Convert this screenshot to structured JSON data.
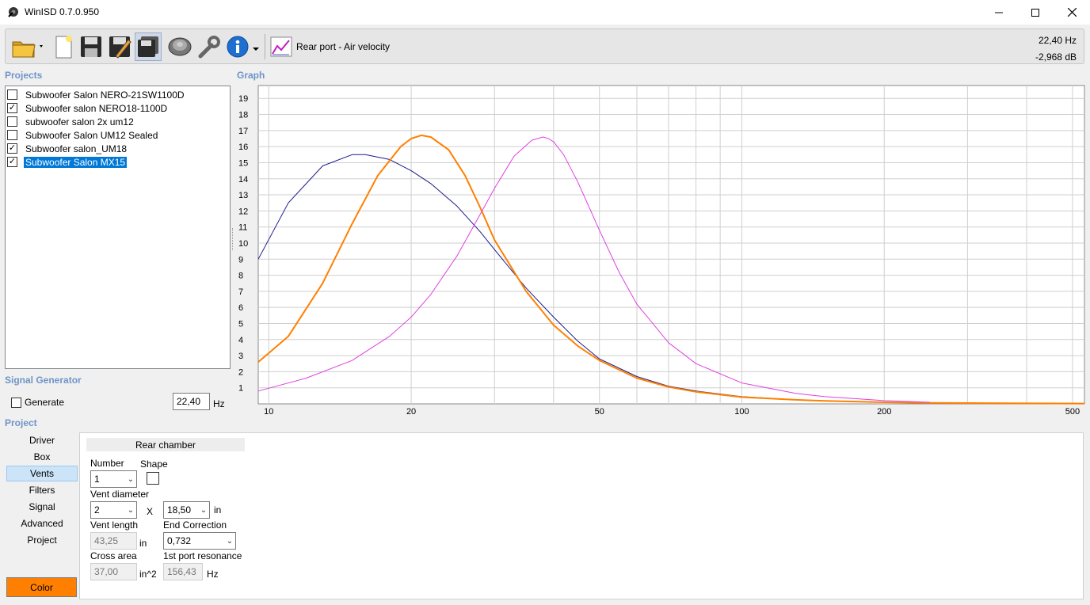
{
  "window": {
    "title": "WinISD 0.7.0.950"
  },
  "toolbar": {
    "view_label": "Rear port - Air velocity",
    "readout_freq": "22,40 Hz",
    "readout_db": "-2,968 dB"
  },
  "projects": {
    "label": "Projects",
    "items": [
      {
        "label": "Subwoofer Salon NERO-21SW1100D",
        "checked": false
      },
      {
        "label": "Subwoofer salon NERO18-1100D",
        "checked": true
      },
      {
        "label": "subwoofer salon 2x um12",
        "checked": false
      },
      {
        "label": "Subwoofer Salon UM12 Sealed",
        "checked": false
      },
      {
        "label": "Subwoofer salon_UM18",
        "checked": true
      },
      {
        "label": "Subwoofer Salon MX15",
        "checked": true
      }
    ]
  },
  "signal_generator": {
    "label": "Signal Generator",
    "generate_label": "Generate",
    "frequency": "22,40",
    "unit": "Hz"
  },
  "graph": {
    "label": "Graph"
  },
  "chart_data": {
    "type": "line",
    "xscale": "log",
    "xlim": [
      9.5,
      530
    ],
    "ylim": [
      0,
      19.8
    ],
    "grid": true,
    "xticks": [
      10,
      20,
      50,
      100,
      200,
      500
    ],
    "yticks": [
      1,
      2,
      3,
      4,
      5,
      6,
      7,
      8,
      9,
      10,
      11,
      12,
      13,
      14,
      15,
      16,
      17,
      18,
      19
    ],
    "series": [
      {
        "color": "#1a1a8c",
        "x": [
          9.5,
          11,
          13,
          15,
          16,
          18,
          20,
          22,
          25,
          28,
          30,
          35,
          40,
          45,
          50,
          60,
          70,
          80,
          100,
          130,
          150,
          200,
          250
        ],
        "y": [
          9.0,
          12.5,
          14.8,
          15.5,
          15.5,
          15.2,
          14.5,
          13.7,
          12.3,
          10.7,
          9.6,
          7.2,
          5.4,
          3.9,
          2.8,
          1.7,
          1.1,
          0.8,
          0.45,
          0.25,
          0.18,
          0.1,
          0.06
        ]
      },
      {
        "color": "#ff8000",
        "x": [
          9.5,
          11,
          13,
          15,
          17,
          19,
          20,
          21,
          22,
          24,
          26,
          28,
          30,
          35,
          40,
          45,
          50,
          60,
          70,
          80,
          100,
          130,
          150,
          200,
          250,
          530
        ],
        "y": [
          2.6,
          4.2,
          7.5,
          11.2,
          14.2,
          16.0,
          16.5,
          16.7,
          16.6,
          15.8,
          14.2,
          12.2,
          10.2,
          7.0,
          4.9,
          3.6,
          2.7,
          1.6,
          1.05,
          0.75,
          0.42,
          0.25,
          0.18,
          0.1,
          0.06,
          0.02
        ]
      },
      {
        "color": "#e040e0",
        "x": [
          9.5,
          12,
          15,
          18,
          20,
          22,
          25,
          28,
          30,
          33,
          36,
          38,
          39,
          40,
          42,
          45,
          50,
          55,
          60,
          70,
          80,
          100,
          130,
          150,
          200,
          250
        ],
        "y": [
          0.8,
          1.6,
          2.7,
          4.2,
          5.4,
          6.8,
          9.2,
          11.8,
          13.4,
          15.4,
          16.4,
          16.6,
          16.5,
          16.3,
          15.5,
          13.8,
          10.8,
          8.2,
          6.2,
          3.8,
          2.5,
          1.3,
          0.65,
          0.45,
          0.2,
          0.1
        ]
      }
    ]
  },
  "project_section": {
    "label": "Project",
    "nav": [
      "Driver",
      "Box",
      "Vents",
      "Filters",
      "Signal",
      "Advanced",
      "Project"
    ],
    "active": "Vents",
    "color_button": "Color",
    "color": "#ff8000"
  },
  "vents": {
    "header": "Rear chamber",
    "number_label": "Number",
    "number_value": "1",
    "shape_label": "Shape",
    "vent_diameter_label": "Vent diameter",
    "diameter_count": "2",
    "x_label": "X",
    "diameter_value": "18,50",
    "diameter_unit": "in",
    "vent_length_label": "Vent length",
    "vent_length_value": "43,25",
    "vent_length_unit": "in",
    "end_correction_label": "End Correction",
    "end_correction_value": "0,732",
    "cross_area_label": "Cross area",
    "cross_area_value": "37,00",
    "cross_area_unit": "in^2",
    "port_resonance_label": "1st port resonance",
    "port_resonance_value": "156,43",
    "port_resonance_unit": "Hz"
  }
}
